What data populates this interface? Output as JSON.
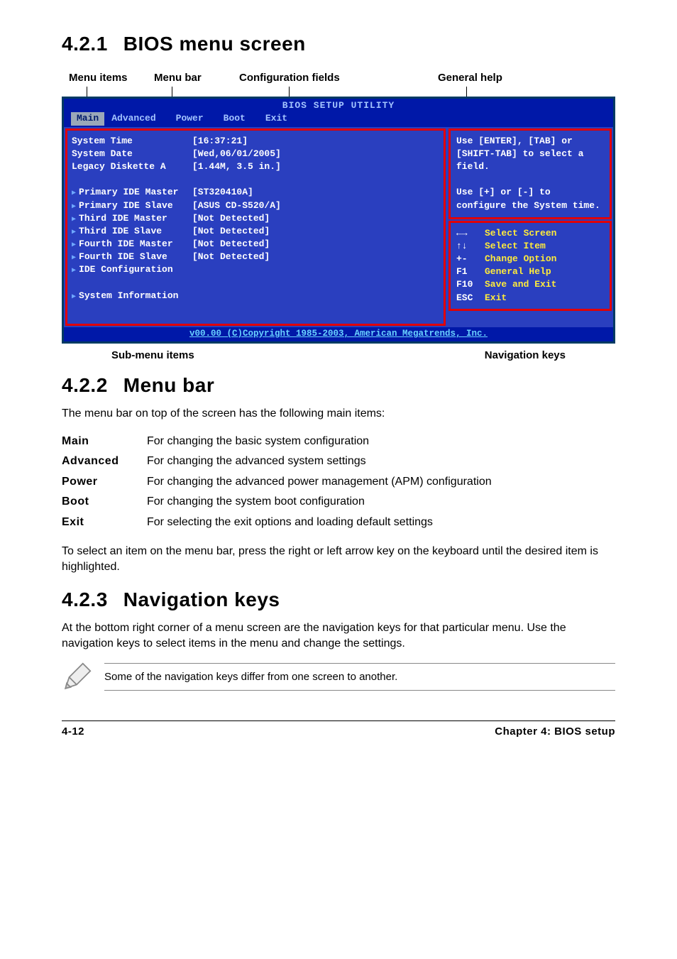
{
  "sections": {
    "s1": {
      "num": "4.2.1",
      "title": "BIOS menu screen"
    },
    "s2": {
      "num": "4.2.2",
      "title": "Menu bar"
    },
    "s3": {
      "num": "4.2.3",
      "title": "Navigation keys"
    }
  },
  "top_labels": {
    "menu_items": "Menu items",
    "menu_bar": "Menu bar",
    "config_fields": "Configuration fields",
    "general_help": "General help"
  },
  "bios": {
    "title": "BIOS SETUP UTILITY",
    "tabs": [
      "Main",
      "Advanced",
      "Power",
      "Boot",
      "Exit"
    ],
    "selected_tab": "Main",
    "fields": [
      {
        "label": "System Time",
        "value": "[16:37:21]"
      },
      {
        "label": "System Date",
        "value": "[Wed,06/01/2005]"
      },
      {
        "label": "Legacy Diskette A",
        "value": "[1.44M, 3.5 in.]"
      }
    ],
    "ide": [
      {
        "label": "Primary IDE Master",
        "value": "[ST320410A]"
      },
      {
        "label": "Primary IDE Slave",
        "value": "[ASUS CD-S520/A]"
      },
      {
        "label": "Third IDE Master",
        "value": "[Not Detected]"
      },
      {
        "label": "Third IDE Slave",
        "value": "[Not Detected]"
      },
      {
        "label": "Fourth IDE Master",
        "value": "[Not Detected]"
      },
      {
        "label": "Fourth IDE Slave",
        "value": "[Not Detected]"
      },
      {
        "label": "IDE Configuration",
        "value": ""
      }
    ],
    "sysinfo_label": "System Information",
    "help_text": "Use [ENTER], [TAB] or [SHIFT-TAB] to select a field.\n\nUse [+] or [-] to configure the System time.",
    "nav": [
      {
        "key": "←→",
        "act": "Select Screen"
      },
      {
        "key": "↑↓",
        "act": "Select Item"
      },
      {
        "key": "+-",
        "act": "Change Option"
      },
      {
        "key": "F1",
        "act": "General Help"
      },
      {
        "key": "F10",
        "act": "Save and Exit"
      },
      {
        "key": "ESC",
        "act": "Exit"
      }
    ],
    "footer": "v00.00 (C)Copyright 1985-2003, American Megatrends, Inc."
  },
  "under_labels": {
    "sub": "Sub-menu items",
    "nav": "Navigation keys"
  },
  "menu_bar_intro": "The menu bar on top of the screen has the following main items:",
  "menu_bar_items": [
    {
      "k": "Main",
      "v": "For changing the basic system configuration"
    },
    {
      "k": "Advanced",
      "v": "For changing the advanced system settings"
    },
    {
      "k": "Power",
      "v": "For changing the advanced power management (APM) configuration"
    },
    {
      "k": "Boot",
      "v": "For changing the system boot configuration"
    },
    {
      "k": "Exit",
      "v": "For selecting the exit options and loading default settings"
    }
  ],
  "menu_bar_outro": "To select an item on the menu bar, press the right or left arrow key on the keyboard until the desired item is highlighted.",
  "nav_keys_para": "At the bottom right corner of a menu screen are the navigation keys for that particular menu. Use the navigation keys to select items in the menu and change the settings.",
  "note": "Some of the navigation keys differ from one screen to another.",
  "footer": {
    "left": "4-12",
    "right": "Chapter 4: BIOS setup"
  }
}
